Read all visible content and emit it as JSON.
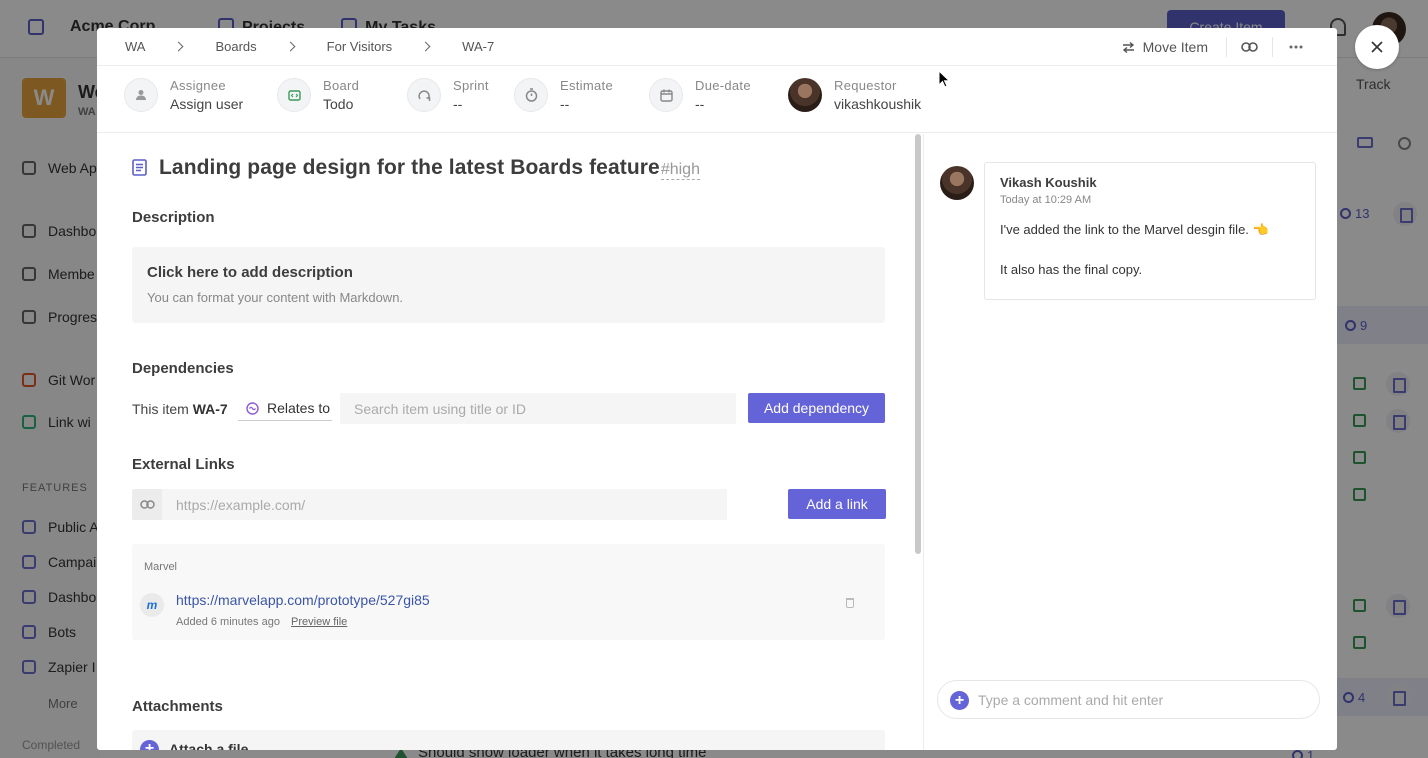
{
  "background": {
    "org_name": "Acme Corp",
    "nav": [
      "Projects",
      "My Tasks"
    ],
    "create_label": "Create Item",
    "workspace_initial": "W",
    "workspace_name": "We",
    "workspace_sub": "WA",
    "sidebar_items": [
      "Web Ap",
      "Dashbo",
      "Membe",
      "Progres",
      "Git Wor",
      "Link wi"
    ],
    "features_heading": "FEATURES",
    "feature_items": [
      "Public A",
      "Campai",
      "Dashbo",
      "Bots",
      "Zapier I"
    ],
    "more_label": "More",
    "completed_label": "Completed",
    "track_label": "Track",
    "badges": [
      "13",
      "9",
      "4",
      "1"
    ],
    "bottom_row_text": "Should show loader when it takes long time"
  },
  "modal": {
    "breadcrumb": [
      "WA",
      "Boards",
      "For Visitors",
      "WA-7"
    ],
    "actions": {
      "move_item": "Move Item"
    },
    "meta": {
      "assignee_label": "Assignee",
      "assignee_value": "Assign user",
      "board_label": "Board",
      "board_value": "Todo",
      "sprint_label": "Sprint",
      "sprint_value": "--",
      "estimate_label": "Estimate",
      "estimate_value": "--",
      "due_label": "Due-date",
      "due_value": "--",
      "requestor_label": "Requestor",
      "requestor_value": "vikashkoushik"
    },
    "title": "Landing page design for the latest Boards feature",
    "priority": "#high",
    "description": {
      "heading": "Description",
      "cta": "Click here to add description",
      "hint": "You can format your content with Markdown."
    },
    "dependencies": {
      "heading": "Dependencies",
      "this_item_prefix": "This item",
      "item_id": "WA-7",
      "relation": "Relates to",
      "search_placeholder": "Search item using title or ID",
      "add_button": "Add dependency"
    },
    "external_links": {
      "heading": "External Links",
      "placeholder": "https://example.com/",
      "add_button": "Add a link",
      "links": [
        {
          "source": "Marvel",
          "logo_letter": "m",
          "url": "https://marvelapp.com/prototype/527gi85",
          "added": "Added 6 minutes ago",
          "preview": "Preview file"
        }
      ]
    },
    "attachments": {
      "heading": "Attachments",
      "attach_label": "Attach a file"
    },
    "comments": [
      {
        "author": "Vikash Koushik",
        "time": "Today at 10:29 AM",
        "line1": "I've added the link to the Marvel desgin file. 👈",
        "line2": "It also has the final copy."
      }
    ],
    "comment_placeholder": "Type a comment and hit enter"
  },
  "colors": {
    "primary": "#6563d8",
    "link": "#3a55a8",
    "overlay": "rgba(0,0,0,0.46)"
  }
}
